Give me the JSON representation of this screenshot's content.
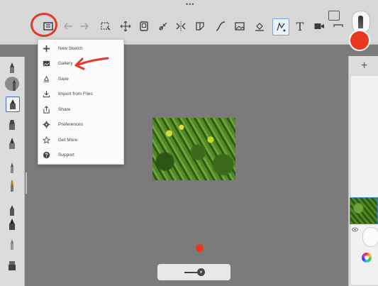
{
  "menu": {
    "items": [
      {
        "label": "New Sketch",
        "icon": "plus-icon"
      },
      {
        "label": "Gallery",
        "icon": "gallery-icon"
      },
      {
        "label": "Save",
        "icon": "save-icon"
      },
      {
        "label": "Import from Files",
        "icon": "import-icon"
      },
      {
        "label": "Share",
        "icon": "share-icon"
      },
      {
        "label": "Preferences",
        "icon": "gear-icon"
      },
      {
        "label": "Get More",
        "icon": "star-icon"
      },
      {
        "label": "Support",
        "icon": "help-icon"
      }
    ]
  },
  "toolbar": {
    "menu_icon": "menu-list-icon",
    "undo_icon": "undo-icon",
    "redo_icon": "redo-icon",
    "text_tool": "T",
    "tools": [
      "selection-icon",
      "transform-icon",
      "frame-icon",
      "ruler-icon",
      "symmetry-icon",
      "perspective-icon",
      "curve-icon",
      "image-icon",
      "fill-icon",
      "predictive-stroke-icon",
      "text-icon",
      "video-icon",
      "minimize-icon"
    ]
  },
  "right_panel": {
    "add_layer": "+"
  },
  "colors": {
    "accent": "#e8391f",
    "annotation": "#e23a2a",
    "selection": "#3c6db8",
    "canvas": "#7b7b7b"
  }
}
